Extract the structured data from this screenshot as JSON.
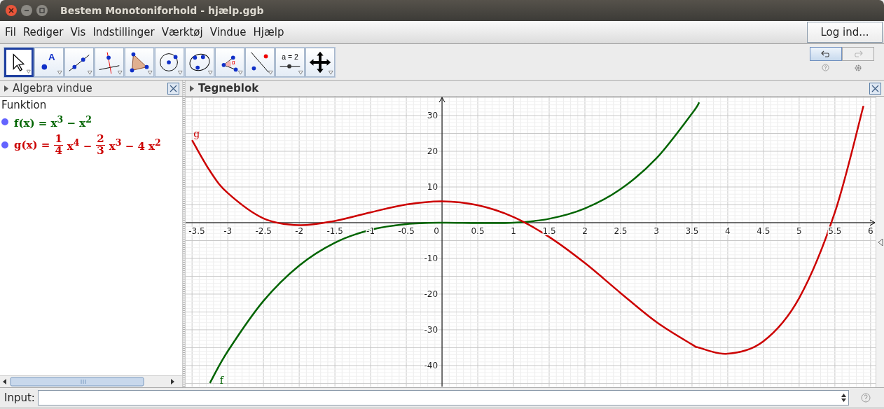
{
  "window": {
    "title": "Bestem Monotoniforhold - hjælp.ggb"
  },
  "menu": [
    "Fil",
    "Rediger",
    "Vis",
    "Indstillinger",
    "Værktøj",
    "Vindue",
    "Hjælp"
  ],
  "login_button": "Log ind...",
  "tools": [
    {
      "kind": "move",
      "selected": true
    },
    {
      "kind": "point",
      "label": "A",
      "selected": false
    },
    {
      "kind": "line",
      "selected": false
    },
    {
      "kind": "perpendicular",
      "selected": false
    },
    {
      "kind": "polygon",
      "selected": false
    },
    {
      "kind": "circle",
      "selected": false
    },
    {
      "kind": "conic",
      "selected": false
    },
    {
      "kind": "angle",
      "label": "α",
      "selected": false
    },
    {
      "kind": "reflect",
      "selected": false
    },
    {
      "kind": "slider",
      "label": "a = 2",
      "selected": false
    },
    {
      "kind": "move-view",
      "selected": false
    }
  ],
  "undo": {
    "disabled": false
  },
  "redo": {
    "disabled": true
  },
  "algebra": {
    "title": "Algebra vindue",
    "heading": "Funktion",
    "items": [
      {
        "visible": true,
        "color": "#006400",
        "tokens": [
          {
            "kind": "text",
            "text": "f(x) = x$^{3}$ − x$^{2}$"
          }
        ]
      },
      {
        "visible": true,
        "color": "#cc0000",
        "tokens": [
          {
            "kind": "text",
            "text": "g(x) ="
          },
          {
            "kind": "frac",
            "num": "1",
            "den": "4"
          },
          {
            "kind": "text",
            "text": "x$^{4}$ −"
          },
          {
            "kind": "frac",
            "num": "2",
            "den": "3"
          },
          {
            "kind": "text",
            "text": "x$^{3}$ − 4 x$^{2}$"
          }
        ]
      }
    ]
  },
  "graphics": {
    "title": "Tegneblok",
    "chart_data": {
      "type": "line",
      "x": [
        -3.5,
        -3.25,
        -3,
        -2.5,
        -2,
        -1.5,
        -1,
        -0.5,
        0,
        0.5,
        1,
        1.5,
        2,
        2.5,
        3,
        3.5,
        3.6,
        4,
        4.5,
        5,
        5.5,
        5.9
      ],
      "series": [
        {
          "name": "f",
          "color": "#006400",
          "values": [
            null,
            -44.9,
            -36,
            -21.9,
            -12,
            -5.6,
            -2,
            -0.4,
            0,
            -0.1,
            0,
            1.1,
            4,
            9.4,
            18,
            30.6,
            33.7,
            null,
            null,
            null,
            null,
            null
          ]
        },
        {
          "name": "g",
          "color": "#cc0000",
          "values": [
            23.1,
            14.5,
            8.3,
            1.2,
            -0.7,
            0.5,
            2.9,
            5.1,
            6,
            4.9,
            1.6,
            -4,
            -11.3,
            -19.7,
            -27.8,
            -34.1,
            -35,
            -36.7,
            -33.2,
            -21.1,
            2.9,
            32.7
          ]
        }
      ],
      "grid": true,
      "xlim": [
        -3.59,
        6.07
      ],
      "ylim": [
        -45.9,
        35.3
      ],
      "xticks": [
        -3.5,
        -3,
        -2.5,
        -2,
        -1.5,
        -1,
        -0.5,
        0,
        0.5,
        1,
        1.5,
        2,
        2.5,
        3,
        3.5,
        4,
        4.5,
        5,
        5.5,
        6
      ],
      "yticks": [
        -40,
        -30,
        -20,
        -10,
        10,
        20,
        30
      ]
    }
  },
  "input_bar": {
    "label": "Input:"
  }
}
